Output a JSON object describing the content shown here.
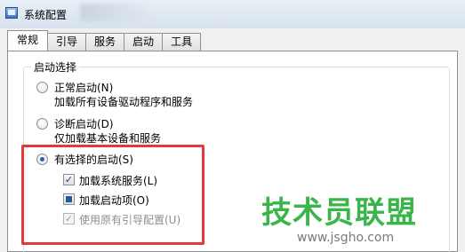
{
  "window": {
    "title": "系统配置",
    "icon": "msconfig-icon"
  },
  "tabs": [
    "常规",
    "引导",
    "服务",
    "启动",
    "工具"
  ],
  "startup_group": {
    "label": "启动选择",
    "normal": {
      "label": "正常启动(N)",
      "desc": "加载所有设备驱动程序和服务",
      "checked": false
    },
    "diagnostic": {
      "label": "诊断启动(D)",
      "desc": "仅加载基本设备和服务",
      "checked": false
    },
    "selective": {
      "label": "有选择的启动(S)",
      "checked": true,
      "options": [
        {
          "label": "加载系统服务(L)",
          "state": "checked",
          "enabled": true
        },
        {
          "label": "加载启动项(O)",
          "state": "indeterminate",
          "enabled": true
        },
        {
          "label": "使用原有引导配置(U)",
          "state": "checked",
          "enabled": false
        }
      ]
    }
  },
  "annotation": {
    "color": "#e23a3a"
  },
  "watermark": {
    "text": "技术员联盟",
    "url": "www.jsgho.com",
    "color": "#39b549"
  }
}
